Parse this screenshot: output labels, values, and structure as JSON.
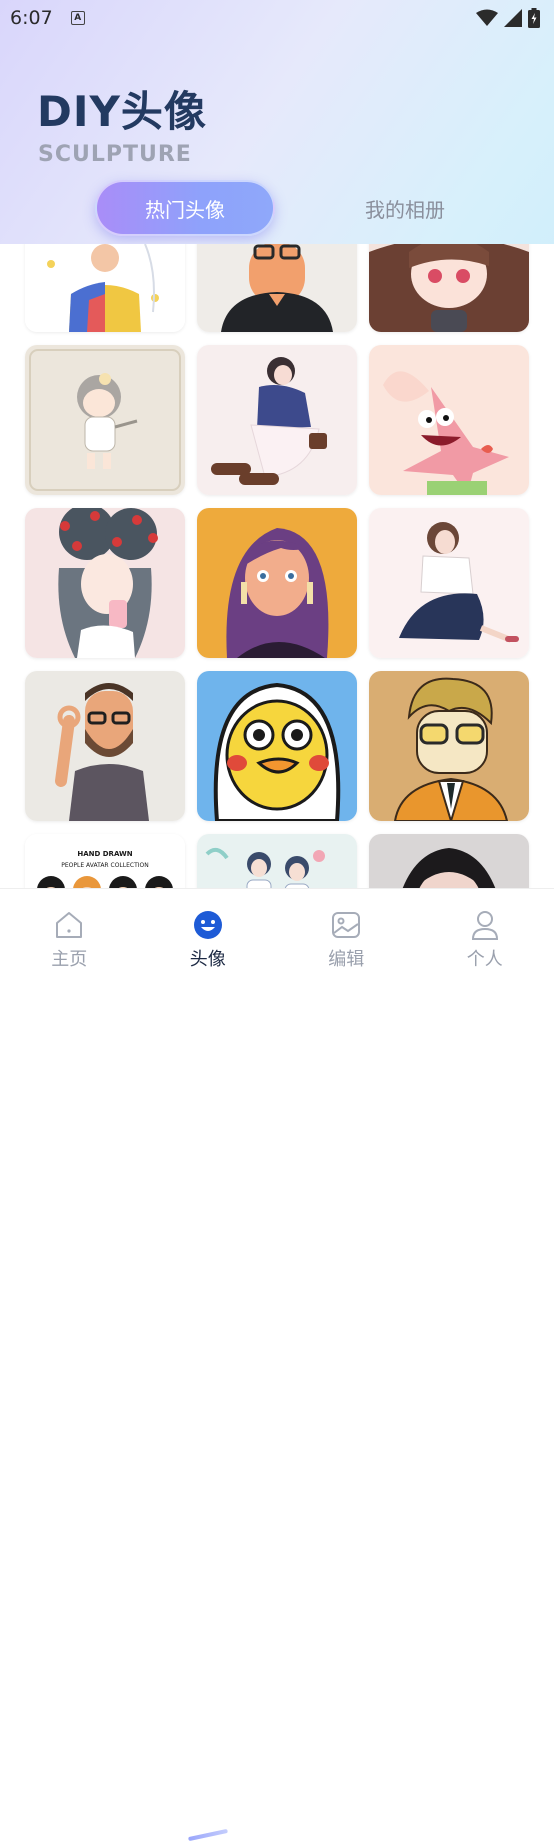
{
  "status": {
    "time": "6:07"
  },
  "hero": {
    "title": "DIY头像",
    "subtitle": "SCULPTURE"
  },
  "tabs": {
    "hot": "热门头像",
    "album": "我的相册"
  },
  "avatars": [
    "avatar-cartoon-boy-flowers",
    "avatar-glasses-man",
    "avatar-anime-girl-brown",
    "avatar-chibi-girl-grey",
    "avatar-sitting-girl",
    "avatar-patrick-star",
    "avatar-anime-girl-berries",
    "avatar-earring-girl",
    "avatar-sitting-girl-dress",
    "avatar-bearded-man-ok",
    "avatar-yellow-duck",
    "avatar-curly-hair-man",
    "avatar-hand-drawn-collection",
    "avatar-couple-illustration",
    "avatar-girl-bangs"
  ],
  "nav": [
    {
      "label": "主页",
      "icon": "home-icon"
    },
    {
      "label": "头像",
      "icon": "avatar-face-icon"
    },
    {
      "label": "编辑",
      "icon": "image-edit-icon"
    },
    {
      "label": "个人",
      "icon": "person-icon"
    }
  ],
  "colors": {
    "accent": "#8ea2fb",
    "title": "#233a61",
    "nav_active": "#1d2a44"
  }
}
